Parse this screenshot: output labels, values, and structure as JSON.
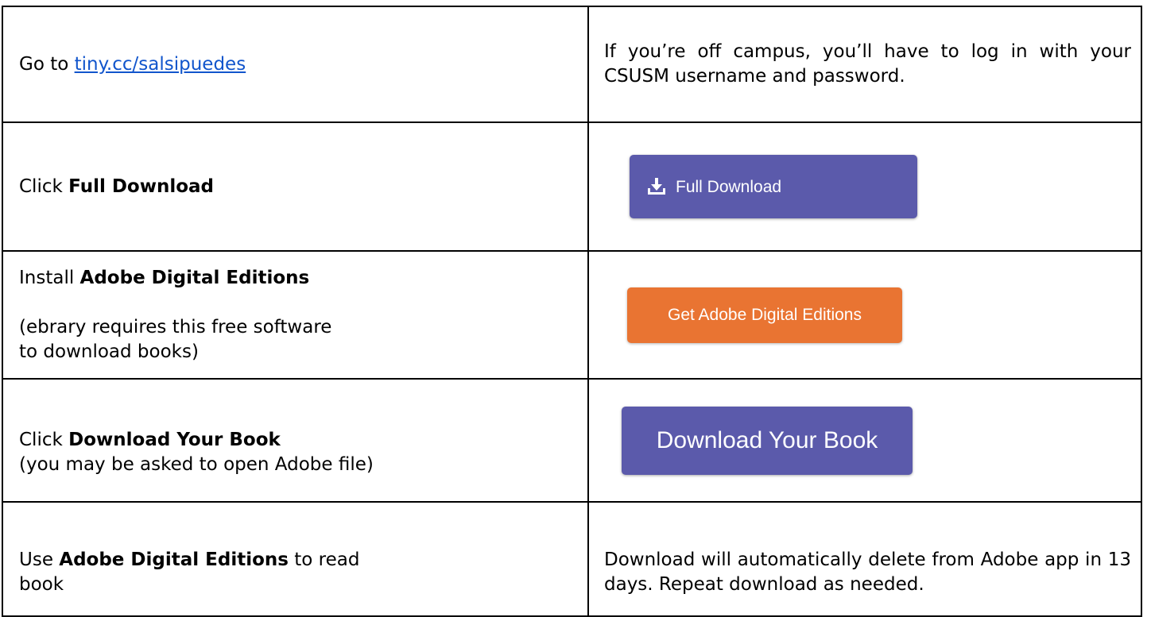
{
  "rows": [
    {
      "left": {
        "prefix": "Go to ",
        "link": "tiny.cc/salsipuedes"
      },
      "right": {
        "note": "If you’re off campus, you’ll have to log in with your CSUSM username and password."
      }
    },
    {
      "left": {
        "prefix": "Click ",
        "bold": "Full Download"
      },
      "right": {
        "button_label": "Full Download",
        "button_icon": "download-icon",
        "button_color": "#5b5aab"
      }
    },
    {
      "left": {
        "prefix": "Install ",
        "bold": "Adobe Digital Editions",
        "note_line1": "(ebrary requires this free software",
        "note_line2": "to download books)"
      },
      "right": {
        "button_label": "Get Adobe Digital Editions",
        "button_color": "#e97432"
      }
    },
    {
      "left": {
        "prefix": "Click ",
        "bold": "Download Your Book",
        "note": "(you may be asked to open Adobe file)"
      },
      "right": {
        "button_label": "Download Your Book",
        "button_color": "#5b5aab"
      }
    },
    {
      "left": {
        "prefix": "Use ",
        "bold": "Adobe Digital Editions",
        "suffix": " to read",
        "line2": "book"
      },
      "right": {
        "note": "Download will automatically delete from Adobe app in 13 days. Repeat download as needed."
      }
    }
  ],
  "colors": {
    "link": "#1155cc",
    "border": "#000000"
  }
}
